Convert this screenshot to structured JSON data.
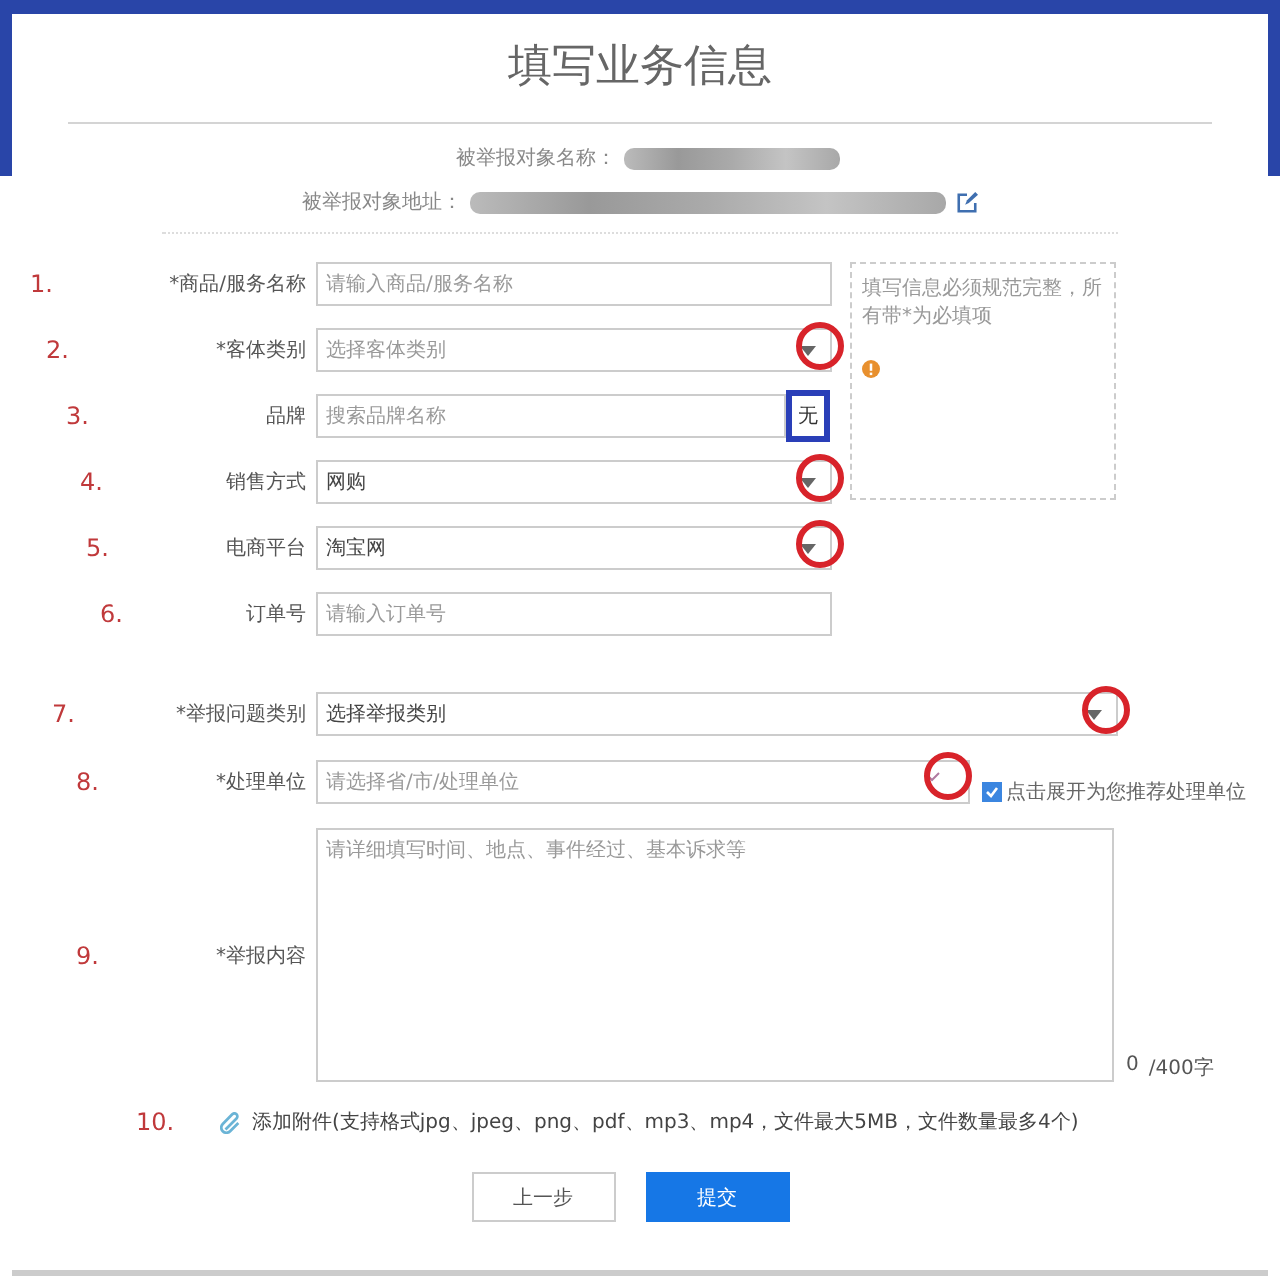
{
  "title": "填写业务信息",
  "target": {
    "name_label": "被举报对象名称：",
    "address_label": "被举报对象地址："
  },
  "product_fields": [
    {
      "number": "1.",
      "label": "*商品/服务名称",
      "kind": "text",
      "placeholder": "请输入商品/服务名称"
    },
    {
      "number": "2.",
      "label": "*客体类别",
      "kind": "select",
      "placeholder": "选择客体类别",
      "circled": true
    },
    {
      "number": "3.",
      "label": "品牌",
      "kind": "search",
      "placeholder": "搜索品牌名称",
      "button": "无",
      "button_boxed": true
    },
    {
      "number": "4.",
      "label": "销售方式",
      "kind": "select",
      "value": "网购",
      "circled": true
    },
    {
      "number": "5.",
      "label": "电商平台",
      "kind": "select",
      "value": "淘宝网",
      "circled": true
    },
    {
      "number": "6.",
      "label": "订单号",
      "kind": "text",
      "placeholder": "请输入订单号"
    }
  ],
  "hint": "填写信息必须规范完整，所有带*为必填项",
  "report_fields": [
    {
      "number": "7.",
      "label": "*举报问题类别",
      "kind": "select",
      "value": "选择举报类别",
      "circled": true
    },
    {
      "number": "8.",
      "label": "*处理单位",
      "kind": "cascade",
      "placeholder": "请选择省/市/处理单位",
      "circled": true,
      "option": {
        "checked": true,
        "label": "点击展开为您推荐处理单位"
      }
    }
  ],
  "content": {
    "number": "9.",
    "label": "*举报内容",
    "placeholder": "请详细填写时间、地点、事件经过、基本诉求等",
    "count": "0",
    "limit": "/400字"
  },
  "attachment": {
    "number": "10.",
    "text": "添加附件(支持格式jpg、jpeg、png、pdf、mp3、mp4，文件最大5MB，文件数量最多4个)"
  },
  "buttons": [
    {
      "label": "上一步",
      "kind": "secondary"
    },
    {
      "label": "提交",
      "kind": "primary"
    }
  ]
}
